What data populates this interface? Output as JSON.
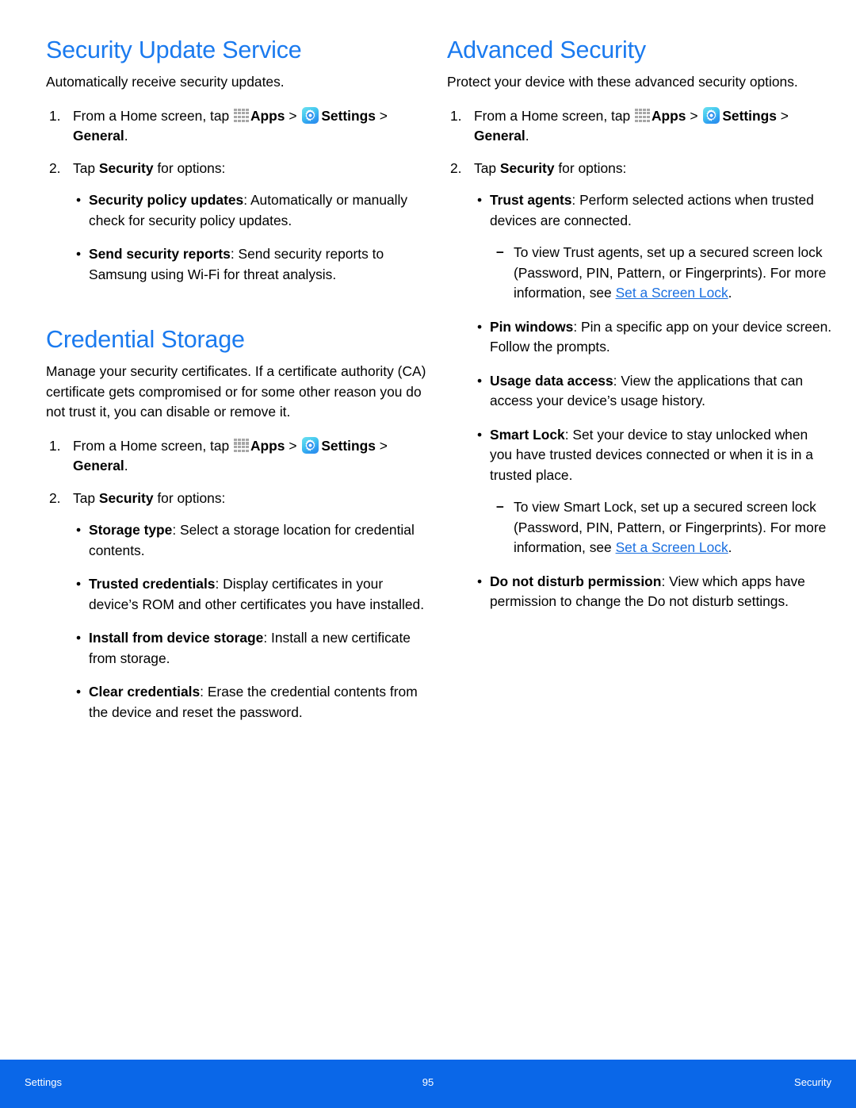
{
  "document": {
    "type": "user-manual-page",
    "accent_color": "#1a7aef",
    "link_color": "#1a6fe0",
    "footer_bar_color": "#0a67e8",
    "text_color": "#000000"
  },
  "icons": {
    "apps": "apps-grid-icon",
    "settings": "settings-gear-icon"
  },
  "left_column": {
    "sections": [
      {
        "title": "Security Update Service",
        "intro": "Automatically receive security updates.",
        "steps": [
          {
            "num": "1.",
            "pre": "From a Home screen, tap ",
            "apps_label": "Apps",
            "sep": " > ",
            "settings_label": "Settings",
            "post_prefix": " > ",
            "post_bold": "General",
            "post_end": "."
          },
          {
            "num": "2.",
            "pre": "Tap ",
            "bold": "Security",
            "post": " for options:"
          }
        ],
        "bullets": [
          {
            "term": "Security policy updates",
            "desc": ": Automatically or manually check for security policy updates."
          },
          {
            "term": "Send security reports",
            "desc": ": Send security reports to Samsung using Wi-Fi for threat analysis."
          }
        ]
      },
      {
        "title": "Credential Storage",
        "intro": "Manage your security certificates. If a certificate authority (CA) certificate gets compromised or for some other reason you do not trust it, you can disable or remove it.",
        "steps": [
          {
            "num": "1.",
            "pre": "From a Home screen, tap ",
            "apps_label": "Apps",
            "sep": " > ",
            "settings_label": "Settings",
            "post_prefix": " > ",
            "post_bold": "General",
            "post_end": "."
          },
          {
            "num": "2.",
            "pre": "Tap ",
            "bold": "Security",
            "post": " for options:"
          }
        ],
        "bullets": [
          {
            "term": "Storage type",
            "desc": ": Select a storage location for credential contents."
          },
          {
            "term": "Trusted credentials",
            "desc": ": Display certificates in your device’s ROM and other certificates you have installed."
          },
          {
            "term": "Install from device storage",
            "desc": ": Install a new certificate from storage."
          },
          {
            "term": "Clear credentials",
            "desc": ": Erase the credential contents from the device and reset the password."
          }
        ]
      }
    ]
  },
  "right_column": {
    "sections": [
      {
        "title": "Advanced Security",
        "intro": "Protect your device with these advanced security options.",
        "steps": [
          {
            "num": "1.",
            "pre": "From a Home screen, tap ",
            "apps_label": "Apps",
            "sep": " > ",
            "settings_label": "Settings",
            "post_prefix": " > ",
            "post_bold": "General",
            "post_end": "."
          },
          {
            "num": "2.",
            "pre": "Tap ",
            "bold": "Security",
            "post": " for options:"
          }
        ],
        "bullets": [
          {
            "term": "Trust agents",
            "desc": ": Perform selected actions when trusted devices are connected.",
            "sub": [
              {
                "pre": "To view Trust agents, set up a secured screen lock (Password, PIN, Pattern, or Fingerprints). For more information, see ",
                "link": "Set a Screen Lock",
                "post": "."
              }
            ]
          },
          {
            "term": "Pin windows",
            "desc": ": Pin a specific app on your device screen. Follow the prompts."
          },
          {
            "term": "Usage data access",
            "desc": ": View the applications that can access your device’s usage history."
          },
          {
            "term": "Smart Lock",
            "desc": ": Set your device to stay unlocked when you have trusted devices connected or when it is in a trusted place.",
            "sub": [
              {
                "pre": "To view Smart Lock, set up a secured screen lock (Password, PIN, Pattern, or Fingerprints). For more information, see ",
                "link": "Set a Screen Lock",
                "post": "."
              }
            ]
          },
          {
            "term": "Do not disturb permission",
            "desc": ": View which apps have permission to change the Do not disturb settings."
          }
        ]
      }
    ]
  },
  "footer": {
    "left": "Settings",
    "page_number": "95",
    "right": "Security"
  }
}
